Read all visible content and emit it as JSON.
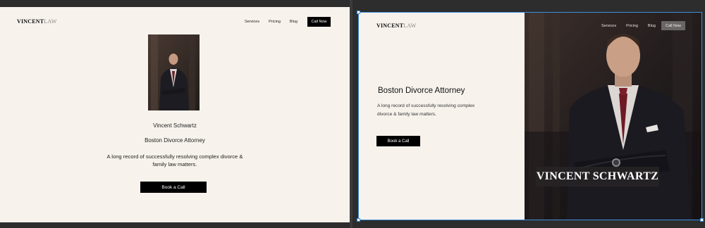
{
  "left_page": {
    "logo_bold": "VINCENT",
    "logo_light": "LAW",
    "nav": [
      "Services",
      "Pricing",
      "Blog"
    ],
    "cta_top": "Call Now",
    "name": "Vincent Schwartz",
    "title": "Boston Divorce Attorney",
    "description_line1": "A long record of successfully resolving complex divorce &",
    "description_line2": "family law matters.",
    "cta_book": "Book a Call"
  },
  "right_page": {
    "logo_bold": "VINCENT",
    "logo_light": "LAW",
    "nav": [
      "Services",
      "Pricing",
      "Blog"
    ],
    "cta_top": "Call Now",
    "heading": "Boston Divorce Attorney",
    "description_line1": "A long record of successfully resolving complex",
    "description_line2": "divorce & family law matters.",
    "cta_book": "Book a Call",
    "hero_name": "VINCENT SCHWARTZ"
  },
  "colors": {
    "page_bg": "#f7f2ec",
    "button": "#000000",
    "selection": "#3d8fe0",
    "editor_bg": "#2d2d2d"
  }
}
